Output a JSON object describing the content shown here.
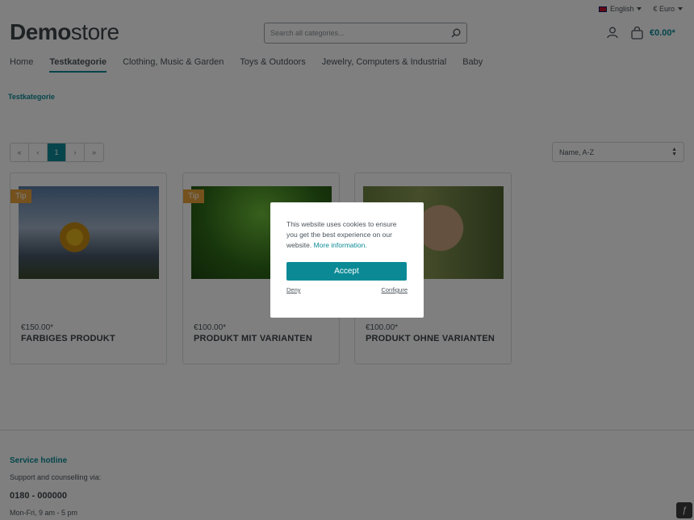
{
  "topbar": {
    "language": "English",
    "currency": "€ Euro"
  },
  "logo": {
    "bold": "Demo",
    "light": "store"
  },
  "search": {
    "placeholder": "Search all categories..."
  },
  "cart": {
    "total": "€0.00*"
  },
  "nav": [
    "Home",
    "Testkategorie",
    "Clothing, Music & Garden",
    "Toys & Outdoors",
    "Jewelry, Computers & Industrial",
    "Baby"
  ],
  "breadcrumb": "Testkategorie",
  "pagination": {
    "first": "«",
    "prev": "‹",
    "current": "1",
    "next": "›",
    "last": "»"
  },
  "sort": {
    "selected": "Name, A-Z"
  },
  "products": [
    {
      "badge": "Tip",
      "price": "€150.00*",
      "name": "FARBIGES PRODUKT",
      "image": "sunflower"
    },
    {
      "badge": "Tip",
      "price": "€100.00*",
      "name": "PRODUKT MIT VARIANTEN",
      "image": "leaf"
    },
    {
      "badge": "",
      "price": "€100.00*",
      "name": "PRODUKT OHNE VARIANTEN",
      "image": "lynx"
    }
  ],
  "footer": {
    "heading": "Service hotline",
    "sub": "Support and counselling via:",
    "phone": "0180 - 000000",
    "hours": "Mon-Fri, 9 am - 5 pm"
  },
  "cookie": {
    "text": "This website uses cookies to ensure you get the best experience on our website.",
    "more": "More information.",
    "accept": "Accept",
    "deny": "Deny",
    "configure": "Configure"
  },
  "colors": {
    "accent": "#0b8a96",
    "badge": "#e9a23b"
  }
}
